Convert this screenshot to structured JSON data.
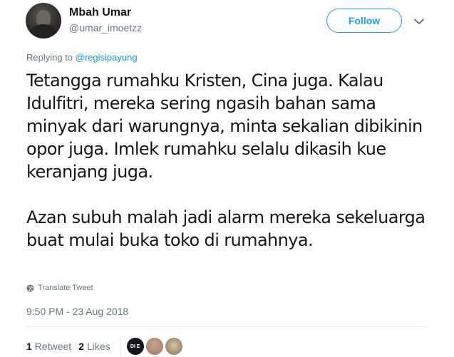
{
  "author": {
    "display_name": "Mbah Umar",
    "handle": "@umar_imoetzz"
  },
  "actions": {
    "follow_label": "Follow"
  },
  "reply": {
    "prefix": "Replying to",
    "to_handle": "@regisipayung"
  },
  "tweet": {
    "paragraphs": [
      "Tetangga rumahku Kristen, Cina juga. Kalau Idulfitri, mereka sering ngasih bahan sama minyak dari warungnya, minta sekalian dibikinin opor juga. Imlek rumahku selalu dikasih kue keranjang juga.",
      "Azan subuh malah jadi alarm mereka sekeluarga buat mulai buka toko di rumahnya."
    ],
    "translate_label": "Translate Tweet",
    "timestamp": "9:50 PM - 23 Aug 2018"
  },
  "stats": {
    "retweets_count": "1",
    "retweets_label": "Retweet",
    "likes_count": "2",
    "likes_label": "Likes"
  },
  "likers": [
    {
      "initials": "DI E"
    },
    {
      "initials": ""
    },
    {
      "initials": ""
    }
  ],
  "colors": {
    "accent": "#1da1f2",
    "muted": "#657786",
    "link": "#1b95e0",
    "text": "#14171a"
  },
  "icons": {
    "caret": "chevron-down-icon",
    "translate": "globe-icon"
  }
}
